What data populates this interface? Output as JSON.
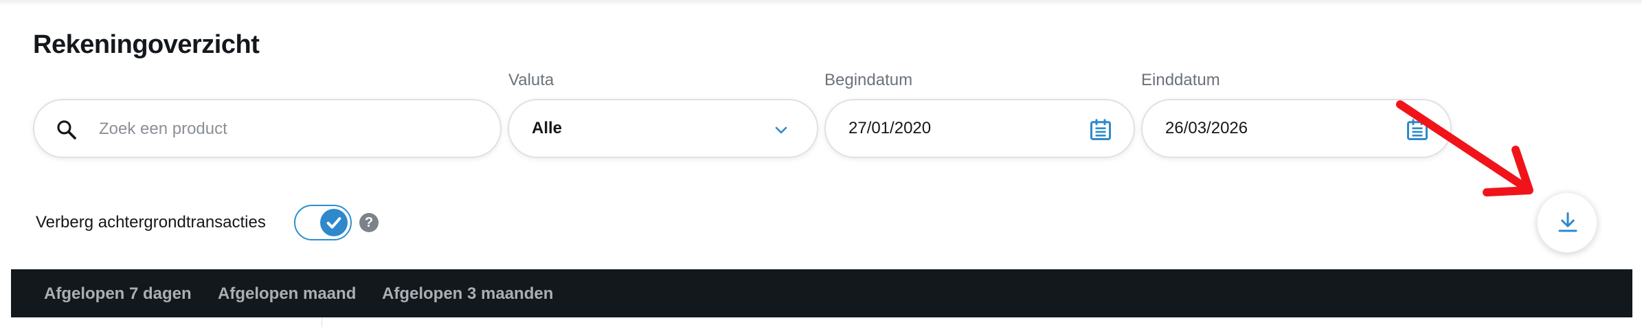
{
  "page": {
    "title": "Rekeningoverzicht"
  },
  "search": {
    "placeholder": "Zoek een product",
    "value": "",
    "icon": "search-icon"
  },
  "currency": {
    "label": "Valuta",
    "value": "Alle",
    "icon": "chevron-down-icon"
  },
  "start_date": {
    "label": "Begindatum",
    "value": "27/01/2020",
    "icon": "calendar-icon"
  },
  "end_date": {
    "label": "Einddatum",
    "value": "26/03/2026",
    "icon": "calendar-icon"
  },
  "background_toggle": {
    "label": "Verberg achtergrondtransacties",
    "checked": true,
    "help_symbol": "?",
    "icon": "check-icon"
  },
  "download": {
    "icon": "download-icon"
  },
  "annotation": {
    "icon": "red-arrow-icon",
    "color": "#f0141a"
  },
  "tabs": [
    {
      "label": "Afgelopen 7 dagen"
    },
    {
      "label": "Afgelopen maand"
    },
    {
      "label": "Afgelopen 3 maanden"
    }
  ],
  "colors": {
    "accent": "#2e89cc",
    "tab_bar_bg": "#12181c",
    "tab_text": "#a9afb5",
    "annotation_red": "#f0141a"
  }
}
